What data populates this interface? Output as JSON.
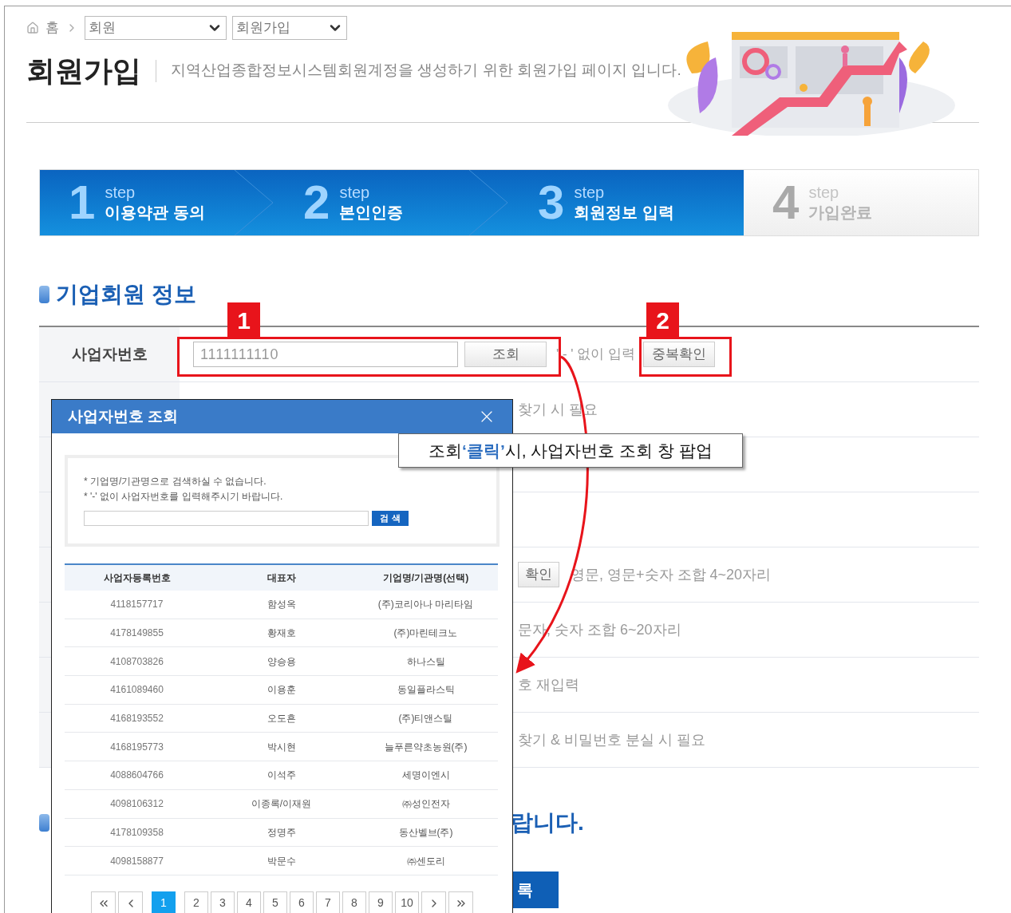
{
  "breadcrumb": {
    "home": "홈",
    "selects": [
      {
        "value": "회원"
      },
      {
        "value": "회원가입"
      }
    ]
  },
  "page_title": "회원가입",
  "page_description": "지역산업종합정보시스템회원계정을 생성하기 위한 회원가입 페이지 입니다.",
  "steps": [
    {
      "number": "1",
      "label": "step",
      "title": "이용약관 동의",
      "active": true
    },
    {
      "number": "2",
      "label": "step",
      "title": "본인인증",
      "active": true
    },
    {
      "number": "3",
      "label": "step",
      "title": "회원정보 입력",
      "active": true
    },
    {
      "number": "4",
      "label": "step",
      "title": "가입완료",
      "active": false
    }
  ],
  "section_title": "기업회원 정보",
  "form_rows": [
    {
      "kind": "lookup",
      "label": "사업자번호",
      "value": "1111111110",
      "lookup_button": "조회",
      "hint": "' - ' 없이 입력",
      "check_button": "중복확인"
    },
    {
      "kind": "hint",
      "hint": "찾기 시 필요"
    },
    {
      "kind": "blank"
    },
    {
      "kind": "blank"
    },
    {
      "kind": "hint",
      "button": "확인",
      "hint": "영문, 영문+숫자 조합 4~20자리"
    },
    {
      "kind": "hint",
      "hint": "문자, 숫자 조합 6~20자리"
    },
    {
      "kind": "hint",
      "hint": "호 재입력"
    },
    {
      "kind": "hint",
      "hint": "찾기 & 비밀번호 분실 시 필요"
    }
  ],
  "second_heading": "랍니다.",
  "submit_button": "록",
  "popup": {
    "title": "사업자번호 조회",
    "notes": [
      "* 기업명/기관명으로 검색하실 수 없습니다.",
      "* '-' 없이 사업자번호를 입력해주시기 바랍니다."
    ],
    "search_button": "검 색",
    "columns": [
      "사업자등록번호",
      "대표자",
      "기업명/기관명(선택)"
    ],
    "rows": [
      [
        "4118157717",
        "함성옥",
        "(주)코리아나 마리타임"
      ],
      [
        "4178149855",
        "황재호",
        "(주)마린테크노"
      ],
      [
        "4108703826",
        "양승용",
        "하나스틸"
      ],
      [
        "4161089460",
        "이용훈",
        "동일플라스틱"
      ],
      [
        "4168193552",
        "오도흔",
        "(주)티앤스틸"
      ],
      [
        "4168195773",
        "박시현",
        "늘푸른약초농원(주)"
      ],
      [
        "4088604766",
        "이석주",
        "세명이엔시"
      ],
      [
        "4098106312",
        "이종록/이재원",
        "㈜성인전자"
      ],
      [
        "4178109358",
        "정명주",
        "동산벨브(주)"
      ],
      [
        "4098158877",
        "박문수",
        "㈜센도리"
      ]
    ],
    "pages": [
      {
        "label": "1",
        "selected": true
      },
      {
        "label": "2",
        "selected": false
      },
      {
        "label": "3",
        "selected": false
      },
      {
        "label": "4",
        "selected": false
      },
      {
        "label": "5",
        "selected": false
      },
      {
        "label": "6",
        "selected": false
      },
      {
        "label": "7",
        "selected": false
      },
      {
        "label": "8",
        "selected": false
      },
      {
        "label": "9",
        "selected": false
      },
      {
        "label": "10",
        "selected": false
      }
    ]
  },
  "annotations": {
    "markers": [
      "1",
      "2"
    ],
    "callout": {
      "before": "조회 ",
      "highlight": "‘클릭’",
      "after": "시, 사업자번호 조회 창 팝업"
    }
  }
}
